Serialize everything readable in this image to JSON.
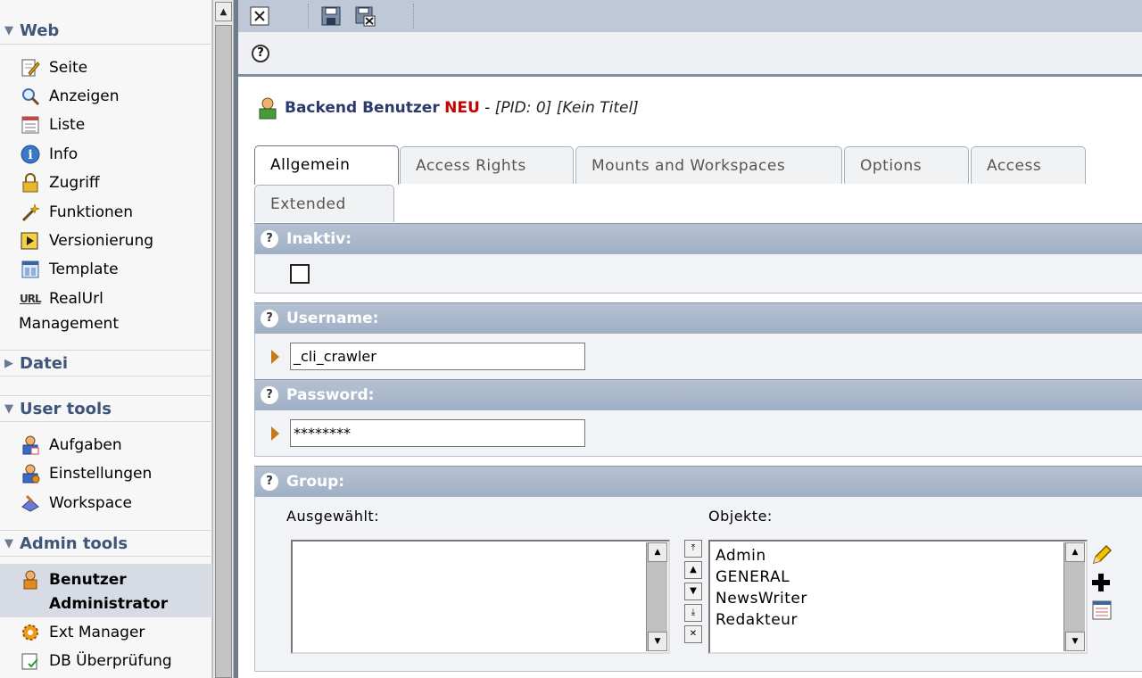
{
  "sidebar": {
    "sections": [
      {
        "title": "Web",
        "expanded": true
      },
      {
        "title": "Datei",
        "expanded": false
      },
      {
        "title": "User tools",
        "expanded": true
      },
      {
        "title": "Admin tools",
        "expanded": true
      }
    ],
    "web_items": [
      "Seite",
      "Anzeigen",
      "Liste",
      "Info",
      "Zugriff",
      "Funktionen",
      "Versionierung",
      "Template",
      "RealUrl"
    ],
    "realurl_continuation": "Management",
    "user_items": [
      "Aufgaben",
      "Einstellungen",
      "Workspace"
    ],
    "admin_items": [
      "Benutzer",
      "Administrator",
      "Ext Manager",
      "DB Überprüfung"
    ]
  },
  "heading": {
    "title": "Backend Benutzer",
    "badge": "NEU",
    "separator": " - ",
    "meta": "[PID: 0] [Kein Titel]"
  },
  "tabs": [
    "Allgemein",
    "Access Rights",
    "Mounts and Workspaces",
    "Options",
    "Access",
    "Extended"
  ],
  "active_tab": "Allgemein",
  "fields": {
    "inaktiv_label": "Inaktiv:",
    "username_label": "Username:",
    "username_value": "_cli_crawler",
    "password_label": "Password:",
    "password_value": "********",
    "group_label": "Group:"
  },
  "group": {
    "selected_label": "Ausgewählt:",
    "objects_label": "Objekte:",
    "objects": [
      "Admin",
      "GENERAL",
      "NewsWriter",
      "Redakteur"
    ]
  },
  "colors": {
    "accent_blue": "#3f5579",
    "header_bar": "#9fafc5",
    "new_badge": "#c50000"
  }
}
